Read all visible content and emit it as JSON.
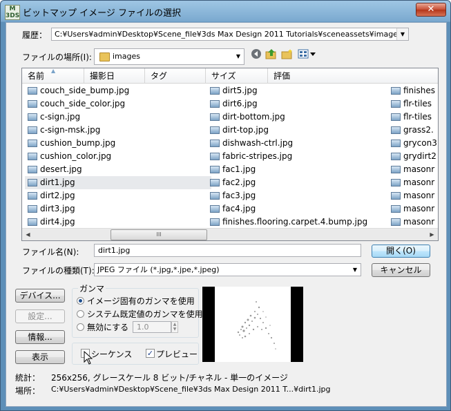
{
  "window": {
    "title": "ビットマップ イメージ ファイルの選択",
    "icon_text": "M\n3DS",
    "close_label": "✕"
  },
  "history": {
    "label": "履歴：",
    "value": "C:¥Users¥admin¥Desktop¥Scene_file¥3ds Max Design 2011 Tutorials¥sceneassets¥images"
  },
  "location": {
    "label": "ファイルの場所(I):",
    "value": "images"
  },
  "columns": [
    "名前",
    "撮影日",
    "タグ",
    "サイズ",
    "評価"
  ],
  "files": {
    "col1": [
      "couch_side_bump.jpg",
      "couch_side_color.jpg",
      "c-sign.jpg",
      "c-sign-msk.jpg",
      "cushion_bump.jpg",
      "cushion_color.jpg",
      "desert.jpg",
      "dirt1.jpg",
      "dirt2.jpg",
      "dirt3.jpg",
      "dirt4.jpg"
    ],
    "col2": [
      "dirt5.jpg",
      "dirt6.jpg",
      "dirt-bottom.jpg",
      "dirt-top.jpg",
      "dishwash-ctrl.jpg",
      "fabric-stripes.jpg",
      "fac1.jpg",
      "fac2.jpg",
      "fac3.jpg",
      "fac4.jpg",
      "finishes.flooring.carpet.4.bump.jpg"
    ],
    "col3": [
      "finishes",
      "flr-tiles",
      "flr-tiles",
      "grass2.",
      "grycon3",
      "grydirt2",
      "masonr",
      "masonr",
      "masonr",
      "masonr",
      "masonr"
    ],
    "selected": "dirt1.jpg"
  },
  "filename": {
    "label": "ファイル名(N):",
    "value": "dirt1.jpg"
  },
  "filetype": {
    "label": "ファイルの種類(T):",
    "value": "JPEG ファイル (*.jpg,*.jpe,*.jpeg)"
  },
  "buttons": {
    "open": "開く(O)",
    "cancel": "キャンセル",
    "devices": "デバイス...",
    "setup": "設定...",
    "info": "情報...",
    "view": "表示"
  },
  "gamma": {
    "title": "ガンマ",
    "option1": "イメージ固有のガンマを使用",
    "option2": "システム既定値のガンマを使用",
    "option3": "無効にする",
    "override_value": "1.0",
    "selected": "option1"
  },
  "options": {
    "sequence": "シーケンス",
    "sequence_checked": false,
    "preview": "プレビュー",
    "preview_checked": true
  },
  "stats": {
    "label": "統計：",
    "value": "256x256, グレースケール 8 ビット/チャネル - 単一のイメージ"
  },
  "place": {
    "label": "場所：",
    "value": "C:¥Users¥admin¥Desktop¥Scene_file¥3ds Max Design 2011 T...¥dirt1.jpg"
  },
  "scroll_thumb_glyph": "III"
}
